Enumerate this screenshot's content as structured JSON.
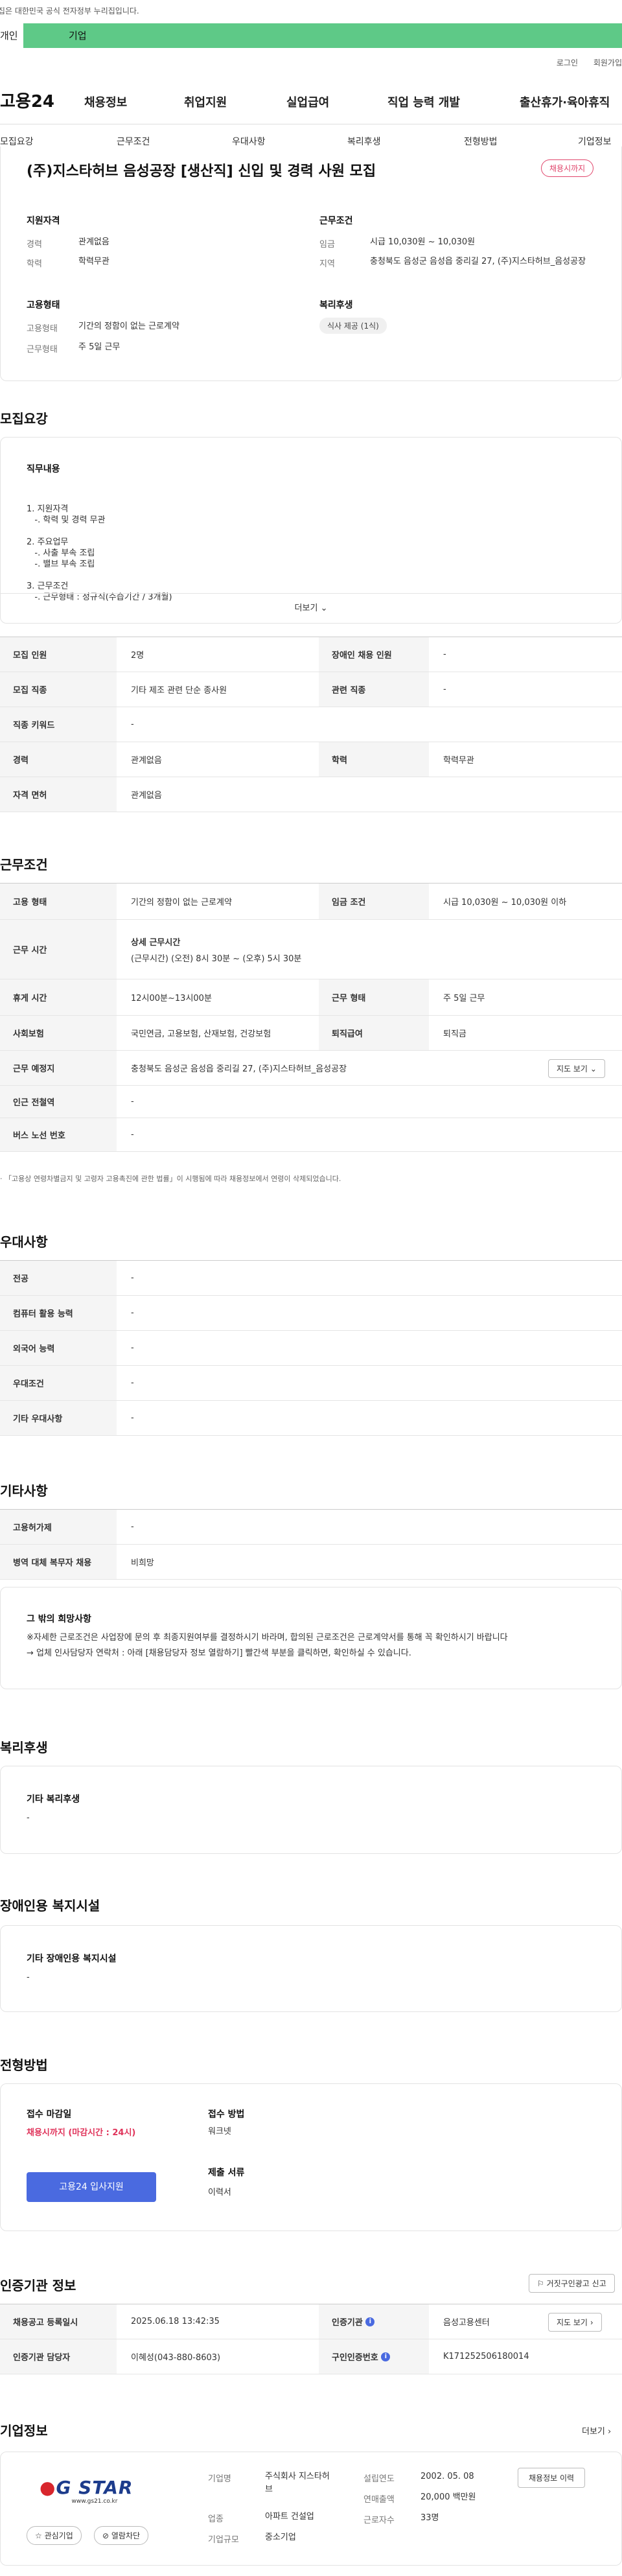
{
  "notice": "이 누리집은 대한민국 공식 전자정부 누리집입니다.",
  "gnb": {
    "person": "개인",
    "corp": "기업"
  },
  "util": {
    "login": "로그인",
    "join": "회원가입"
  },
  "header": {
    "logo": "고용24",
    "nav": [
      "채용정보",
      "취업지원",
      "실업급여",
      "직업 능력 개발",
      "출산휴가·육아휴직"
    ]
  },
  "subnav": [
    "모집요강",
    "근무조건",
    "우대사항",
    "복리후생",
    "전형방법",
    "기업정보"
  ],
  "job": {
    "title": "(주)지스타허브 음성공장 [생산직] 신입 및 경력 사원 모집",
    "badge": "채용시까지",
    "qual": {
      "heading": "지원자격",
      "rows": [
        {
          "label": "경력",
          "value": "관계없음"
        },
        {
          "label": "학력",
          "value": "학력무관"
        }
      ]
    },
    "cond": {
      "heading": "근무조건",
      "rows": [
        {
          "label": "임금",
          "value": "시급 10,030원 ~ 10,030원"
        },
        {
          "label": "지역",
          "value": "충청북도 음성군 음성읍 중리길 27, (주)지스타허브_음성공장"
        }
      ]
    },
    "emp": {
      "heading": "고용형태",
      "rows": [
        {
          "label": "고용형태",
          "value": "기간의 정함이 없는 근로계약"
        },
        {
          "label": "근무형태",
          "value": "주 5일 근무"
        }
      ]
    },
    "welfare": {
      "heading": "복리후생",
      "chip": "식사 제공 (1식)"
    }
  },
  "recruit": {
    "section": "모집요강",
    "duty_heading": "직무내용",
    "duty_lines": [
      "1. 지원자격",
      "   -. 학력 및 경력 무관",
      "",
      "2. 주요업무",
      "   -. 사출 부속 조립",
      "   -. 밸브 부속 조립",
      "",
      "3. 근무조건",
      "   -. 근무형태 : 정규직(수습기간 / 3개월)"
    ],
    "more": "더보기",
    "table": [
      [
        {
          "th": "모집 인원",
          "td": "2명"
        },
        {
          "th": "장애인 채용 인원",
          "td": "-"
        }
      ],
      [
        {
          "th": "모집 직종",
          "td": "기타 제조 관련 단순 종사원"
        },
        {
          "th": "관련 직종",
          "td": "-"
        }
      ],
      [
        {
          "th": "직종 키워드",
          "td": "-"
        }
      ],
      [
        {
          "th": "경력",
          "td": "관계없음"
        },
        {
          "th": "학력",
          "td": "학력무관"
        }
      ],
      [
        {
          "th": "자격 면허",
          "td": "관계없음"
        }
      ]
    ]
  },
  "work": {
    "section": "근무조건",
    "r1": [
      {
        "th": "고용 형태",
        "td": "기간의 정함이 없는 근로계약"
      },
      {
        "th": "임금 조건",
        "td": "시급 10,030원 ~ 10,030원 이하"
      }
    ],
    "r2": {
      "th": "근무 시간",
      "title": "상세 근무시간",
      "td": "(근무시간) (오전) 8시 30분 ~ (오후) 5시 30분"
    },
    "r3": [
      {
        "th": "휴게 시간",
        "td": "12시00분~13시00분"
      },
      {
        "th": "근무 형태",
        "td": "주 5일 근무"
      }
    ],
    "r4": [
      {
        "th": "사회보험",
        "td": "국민연금, 고용보험, 산재보험, 건강보험"
      },
      {
        "th": "퇴직급여",
        "td": "퇴직금"
      }
    ],
    "r5": {
      "th": "근무 예정지",
      "td": "충청북도 음성군 음성읍 중리길 27, (주)지스타허브_음성공장",
      "btn": "지도 보기"
    },
    "r6": {
      "th": "인근 전철역",
      "td": "-"
    },
    "r7": {
      "th": "버스 노선 번호",
      "td": "-"
    },
    "note": "「고용상 연령차별금지 및 고령자 고용촉진에 관한 법률」이 시행됨에 따라 채용정보에서 연령이 삭제되었습니다."
  },
  "pref": {
    "section": "우대사항",
    "rows": [
      {
        "th": "전공",
        "td": "-"
      },
      {
        "th": "컴퓨터 활용 능력",
        "td": "-"
      },
      {
        "th": "외국어 능력",
        "td": "-"
      },
      {
        "th": "우대조건",
        "td": "-"
      },
      {
        "th": "기타 우대사항",
        "td": "-"
      }
    ]
  },
  "etc": {
    "section": "기타사항",
    "rows": [
      {
        "th": "고용허가제",
        "td": "-"
      },
      {
        "th": "병역 대체 복무자 채용",
        "td": "비희망"
      }
    ],
    "box_heading": "그 밖의 희망사항",
    "box_lines": [
      "※자세한 근로조건은 사업장에 문의 후 최종지원여부를 결정하시기 바라며, 합의된 근로조건은 근로계약서를 통해 꼭 확인하시기 바랍니다",
      "→ 업체 인사담당자 연락처 : 아래 [채용담당자 정보 열람하기] 빨간색 부분을 클릭하면, 확인하실 수 있습니다."
    ]
  },
  "benefit": {
    "section": "복리후생",
    "heading": "기타 복리후생",
    "value": "-"
  },
  "facility": {
    "section": "장애인용 복지시설",
    "heading": "기타 장애인용 복지시설",
    "value": "-"
  },
  "selection": {
    "section": "전형방법",
    "deadline_heading": "접수 마감일",
    "deadline": "채용시까지 (마감시간 : 24시)",
    "apply_btn": "고용24 입사지원",
    "method_heading": "접수 방법",
    "method": "워크넷",
    "docs_heading": "제출 서류",
    "docs": "이력서"
  },
  "agency": {
    "section": "인증기관 정보",
    "report_btn": "거짓구인광고 신고",
    "rows": [
      [
        {
          "th": "채용공고 등록일시",
          "td": "2025.06.18 13:42:35"
        },
        {
          "th": "인증기관",
          "td": "음성고용센터",
          "btn": "지도 보기"
        }
      ],
      [
        {
          "th": "인증기관 담당자",
          "td": "이혜성(043-880-8603)"
        },
        {
          "th": "구인인증번호",
          "td": "K171252506180014"
        }
      ]
    ]
  },
  "company": {
    "section": "기업정보",
    "more": "더보기",
    "logo": "G STAR",
    "logo_sub": "www.gs21.co.kr",
    "fav_btn": "관심기업",
    "block_btn": "열람차단",
    "info_btn": "채용정보 이력",
    "left": [
      {
        "label": "기업명",
        "value": "주식회사 지스타허브"
      },
      {
        "label": "업종",
        "value": "아파트 건설업"
      },
      {
        "label": "기업규모",
        "value": "중소기업"
      }
    ],
    "right": [
      {
        "label": "설립연도",
        "value": "2002. 05. 08"
      },
      {
        "label": "연매출액",
        "value": "20,000 백만원"
      },
      {
        "label": "근로자수",
        "value": "33명"
      }
    ]
  }
}
